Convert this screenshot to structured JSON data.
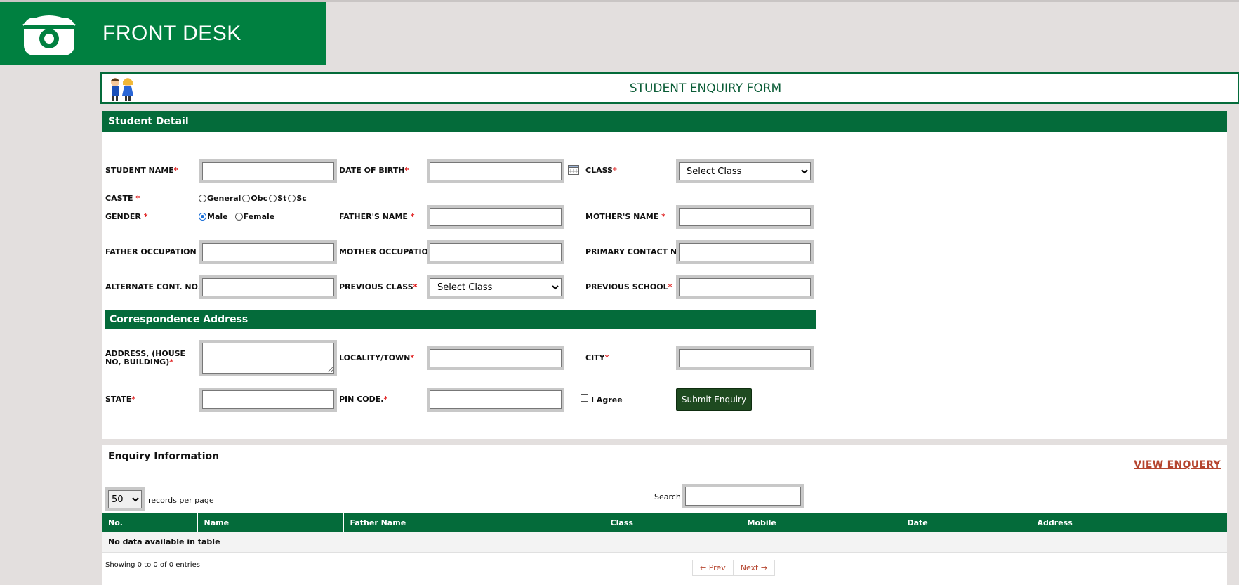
{
  "header": {
    "title": "FRONT DESK",
    "icon": "telephone-icon"
  },
  "form": {
    "title": "STUDENT ENQUIRY FORM",
    "logo": "students-cartoon-icon"
  },
  "student_detail": {
    "section_title": "Student Detail",
    "labels": {
      "student_name": "STUDENT NAME",
      "dob": "DATE OF BIRTH",
      "class": "CLASS",
      "caste": "CASTE",
      "gender": "GENDER",
      "fathers_name": "FATHER'S NAME",
      "mothers_name": "MOTHER'S NAME",
      "father_occupation": "FATHER OCCUPATION",
      "mother_occupation": "MOTHER OCCUPATION",
      "primary_contact": "PRIMARY CONTACT NO",
      "alternate_contact": "ALTERNATE CONT. NO.",
      "previous_class": "PREVIOUS CLASS",
      "previous_school": "PREVIOUS SCHOOL"
    },
    "required_mark": "*",
    "class_select": "Select Class",
    "previous_class_select": "Select Class",
    "caste_options": [
      "General",
      "Obc",
      "St",
      "Sc"
    ],
    "gender_options": [
      "Male",
      "Female"
    ],
    "gender_selected": "Male"
  },
  "address": {
    "section_title": "Correspondence Address",
    "labels": {
      "address": "ADDRESS, (HOUSE NO, BUILDING)",
      "locality": "LOCALITY/TOWN",
      "city": "CITY",
      "state": "STATE",
      "pin": "PIN CODE."
    },
    "agree": "I Agree",
    "submit": "Submit Enquiry"
  },
  "enquiry": {
    "title": "Enquiry Information",
    "view_link": "VIEW ENQUERY",
    "per_page": "50",
    "per_page_text": "records per page",
    "search_label": "Search:",
    "columns": [
      "No.",
      "Name",
      "Father Name",
      "Class",
      "Mobile",
      "Date",
      "Address"
    ],
    "empty_text": "No data available in table",
    "showing": "Showing 0 to 0 of 0 entries",
    "prev": "← Prev",
    "next": "Next →"
  },
  "colors": {
    "brand_green": "#008040",
    "dark_green": "#046b3a",
    "link": "#b5452f",
    "required": "#e02020"
  }
}
